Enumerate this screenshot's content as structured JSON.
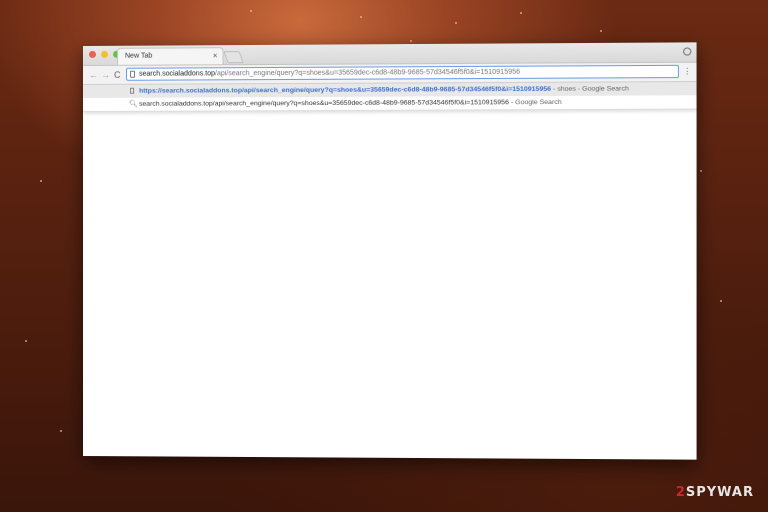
{
  "browser": {
    "tab": {
      "title": "New Tab",
      "close": "×"
    },
    "nav": {
      "back": "←",
      "forward": "→",
      "reload": "C",
      "menu": "⋮"
    },
    "omnibox": {
      "host": "search.socialaddons.top",
      "path": "/api/search_engine/query?q=shoes&u=35659dec-c6d8-48b9-9685-57d34546f5f0&i=1510915956"
    },
    "suggestions": [
      {
        "icon": "page-icon",
        "url": "https://search.socialaddons.top/api/search_engine/query?q=shoes&u=35659dec-c6d8-48b9-9685-57d34546f5f0&i=1510915956",
        "suffix": " - shoes - Google Search"
      },
      {
        "icon": "search-icon",
        "url": "search.socialaddons.top/api/search_engine/query?q=shoes&u=35659dec-c6d8-48b9-9685-57d34546f5f0&i=1510915956",
        "suffix": " - Google Search"
      }
    ]
  },
  "watermark": {
    "prefix": "2",
    "rest": "SPYWAR"
  },
  "colors": {
    "accent": "#3b6fd3",
    "focus_ring": "#6b9be8",
    "watermark_red": "#d2262b"
  }
}
